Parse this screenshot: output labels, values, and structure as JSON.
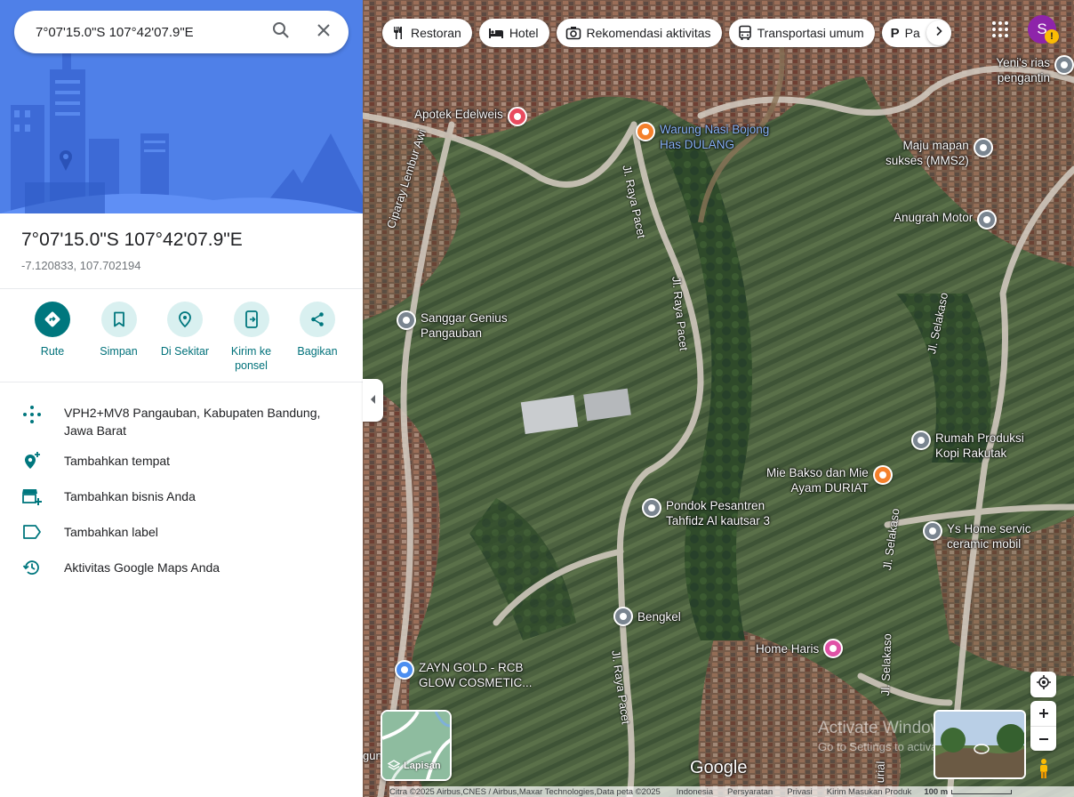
{
  "search": {
    "query": "7°07'15.0\"S 107°42'07.9\"E"
  },
  "place": {
    "title": "7°07'15.0\"S 107°42'07.9\"E",
    "coords": "-7.120833, 107.702194"
  },
  "actions": [
    {
      "label": "Rute"
    },
    {
      "label": "Simpan"
    },
    {
      "label": "Di Sekitar"
    },
    {
      "label": "Kirim ke ponsel"
    },
    {
      "label": "Bagikan"
    }
  ],
  "details": [
    {
      "text": "VPH2+MV8 Pangauban, Kabupaten Bandung, Jawa Barat"
    },
    {
      "text": "Tambahkan tempat"
    },
    {
      "text": "Tambahkan bisnis Anda"
    },
    {
      "text": "Tambahkan label"
    },
    {
      "text": "Aktivitas Google Maps Anda"
    }
  ],
  "chips": [
    {
      "label": "Restoran",
      "icon": "fork-knife-icon"
    },
    {
      "label": "Hotel",
      "icon": "bed-icon"
    },
    {
      "label": "Rekomendasi aktivitas",
      "icon": "camera-icon"
    },
    {
      "label": "Transportasi umum",
      "icon": "bus-icon"
    },
    {
      "label": "Pa",
      "icon": "parking-icon"
    }
  ],
  "account": {
    "initial": "S",
    "warning": "!",
    "color": "#8e24aa"
  },
  "pois": [
    {
      "name": "Yeni's rias pengantin"
    },
    {
      "name": "Apotek Edelweis"
    },
    {
      "name": "Warung Nasi Bojong\nHas DULANG"
    },
    {
      "name": "Maju mapan\nsukses (MMS2)"
    },
    {
      "name": "Anugrah Motor"
    },
    {
      "name": "Sanggar Genius\nPangauban"
    },
    {
      "name": "Rumah Produksi\nKopi Rakutak"
    },
    {
      "name": "Mie Bakso dan Mie\nAyam DURIAT"
    },
    {
      "name": "Pondok Pesantren\nTahfidz Al kautsar 3"
    },
    {
      "name": "Ys Home servic\nceramic mobil"
    },
    {
      "name": "Bengkel"
    },
    {
      "name": "Home Haris"
    },
    {
      "name": "ZAYN GOLD - RCB\nGLOW COSMETIC..."
    }
  ],
  "roads": [
    {
      "name": "Ciparay Lembur Awi"
    },
    {
      "name": "Jl. Raya Pacet"
    },
    {
      "name": "Jl. Raya Pacet"
    },
    {
      "name": "Jl. Raya Pacet"
    },
    {
      "name": "Jl. Selakaso"
    },
    {
      "name": "Jl. Selakaso"
    },
    {
      "name": "Jl. Selakaso"
    },
    {
      "name": "urial"
    },
    {
      "name": "gun"
    }
  ],
  "map_controls": {
    "layers_label": "Lapisan",
    "logo": "Google"
  },
  "watermark": {
    "line1": "Activate Windows",
    "line2": "Go to Settings to activate Windows."
  },
  "footer": {
    "attribution": "Citra ©2025 Airbus,CNES / Airbus,Maxar Technologies,Data peta ©2025",
    "country": "Indonesia",
    "terms": "Persyaratan",
    "privacy": "Privasi",
    "feedback": "Kirim Masukan Produk",
    "scale": "100 m"
  },
  "colors": {
    "teal": "#00777e",
    "poi_gray": "#7a8590",
    "poi_orange": "#f4802b",
    "poi_red": "#e94b5f",
    "poi_pink": "#e052a6",
    "poi_blue": "#4c8ef0",
    "header_blue": "#4f80e8"
  }
}
